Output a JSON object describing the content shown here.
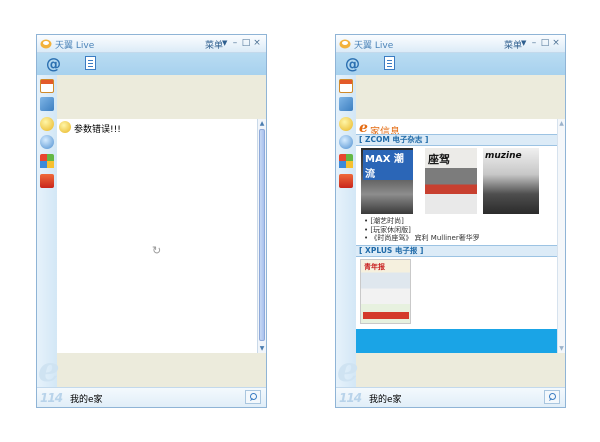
{
  "windows": [
    {
      "title": "天翼 Live",
      "menu_label": "菜单",
      "error_text": "参数错误!!!",
      "bottom_prefix": "114",
      "bottom_label": "我的e家"
    },
    {
      "title": "天翼 Live",
      "menu_label": "菜单",
      "logo_text": "家信息",
      "section1": "[ ZCOM 电子杂志 ]",
      "magazines": [
        "MAX 潮流",
        "座驾",
        "muzine"
      ],
      "links": [
        "• [潮艺时尚]",
        "• [玩家休闲版]",
        "• 《时尚座驾》 宾利 Mulliner奢华罗"
      ],
      "section2": "[ XPLUS 电子报 ]",
      "newspaper": "青年报",
      "bottom_prefix": "114",
      "bottom_label": "我的e家"
    }
  ],
  "colors": {
    "window_border": "#8fb4d6",
    "toolbar_blue": "#a7d1ee",
    "beige_panel": "#ecebdc",
    "accent_orange": "#e36b12",
    "section_blue": "#1f6aa8",
    "promo_bar": "#1aa4e6"
  },
  "icons": [
    "app-logo-icon",
    "mail-at-icon",
    "document-icon",
    "calendar-icon",
    "tools-icon",
    "smiley-icon",
    "ie-icon",
    "windows-icon",
    "gift-box-icon",
    "search-icon",
    "loading-spinner-icon"
  ]
}
